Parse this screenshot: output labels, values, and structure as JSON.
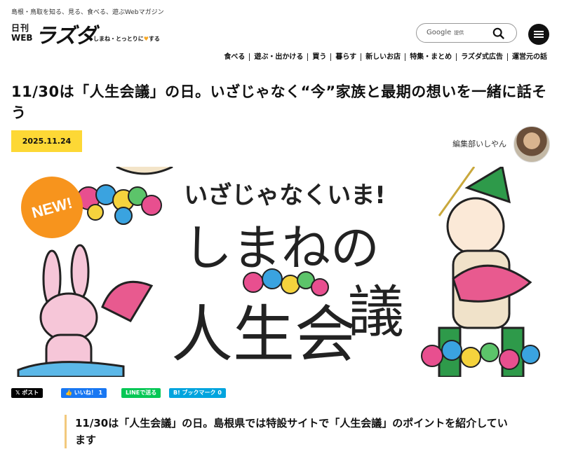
{
  "header": {
    "tagline": "島根・鳥取を知る、見る、食べる、遊ぶWebマガジン",
    "logo": {
      "nikkan": "日刊",
      "web": "WEB",
      "name": "ラズダ",
      "sub_before": "しまね・とっとりに",
      "sub_heart": "♥",
      "sub_after": "する"
    },
    "search": {
      "brand": "Google",
      "brand_sub": "提供"
    },
    "nav": [
      "食べる",
      "遊ぶ・出かける",
      "買う",
      "暮らす",
      "新しいお店",
      "特集・まとめ",
      "ラズダ式広告",
      "運営元の話"
    ]
  },
  "article": {
    "title": "11/30は「人生会議」の日。いざじゃなく“今”家族と最期の想いを一緒に話そう",
    "date": "2025.11.24",
    "author": "編集部いしやん",
    "hero": {
      "badge": "NEW!",
      "headline_small": "いざじゃなくいま!",
      "headline_big_1": "しまねの",
      "headline_big_2": "人生会",
      "headline_big_3": "議"
    },
    "share": {
      "x": "𝕏 ポスト",
      "fb": "👍 いいね！ 1",
      "line": "LINEで送る",
      "hb": "B! ブックマーク 0"
    },
    "lead": "11/30は「人生会議」の日。島根県では特設サイトで「人生会議」のポイントを紹介しています"
  },
  "colors": {
    "accent_yellow": "#fdd835",
    "badge_orange": "#f7941d",
    "fish_pink": "#e85a8f",
    "hat_green": "#2e9a4a",
    "rabbit_pink": "#f6c6d8"
  }
}
